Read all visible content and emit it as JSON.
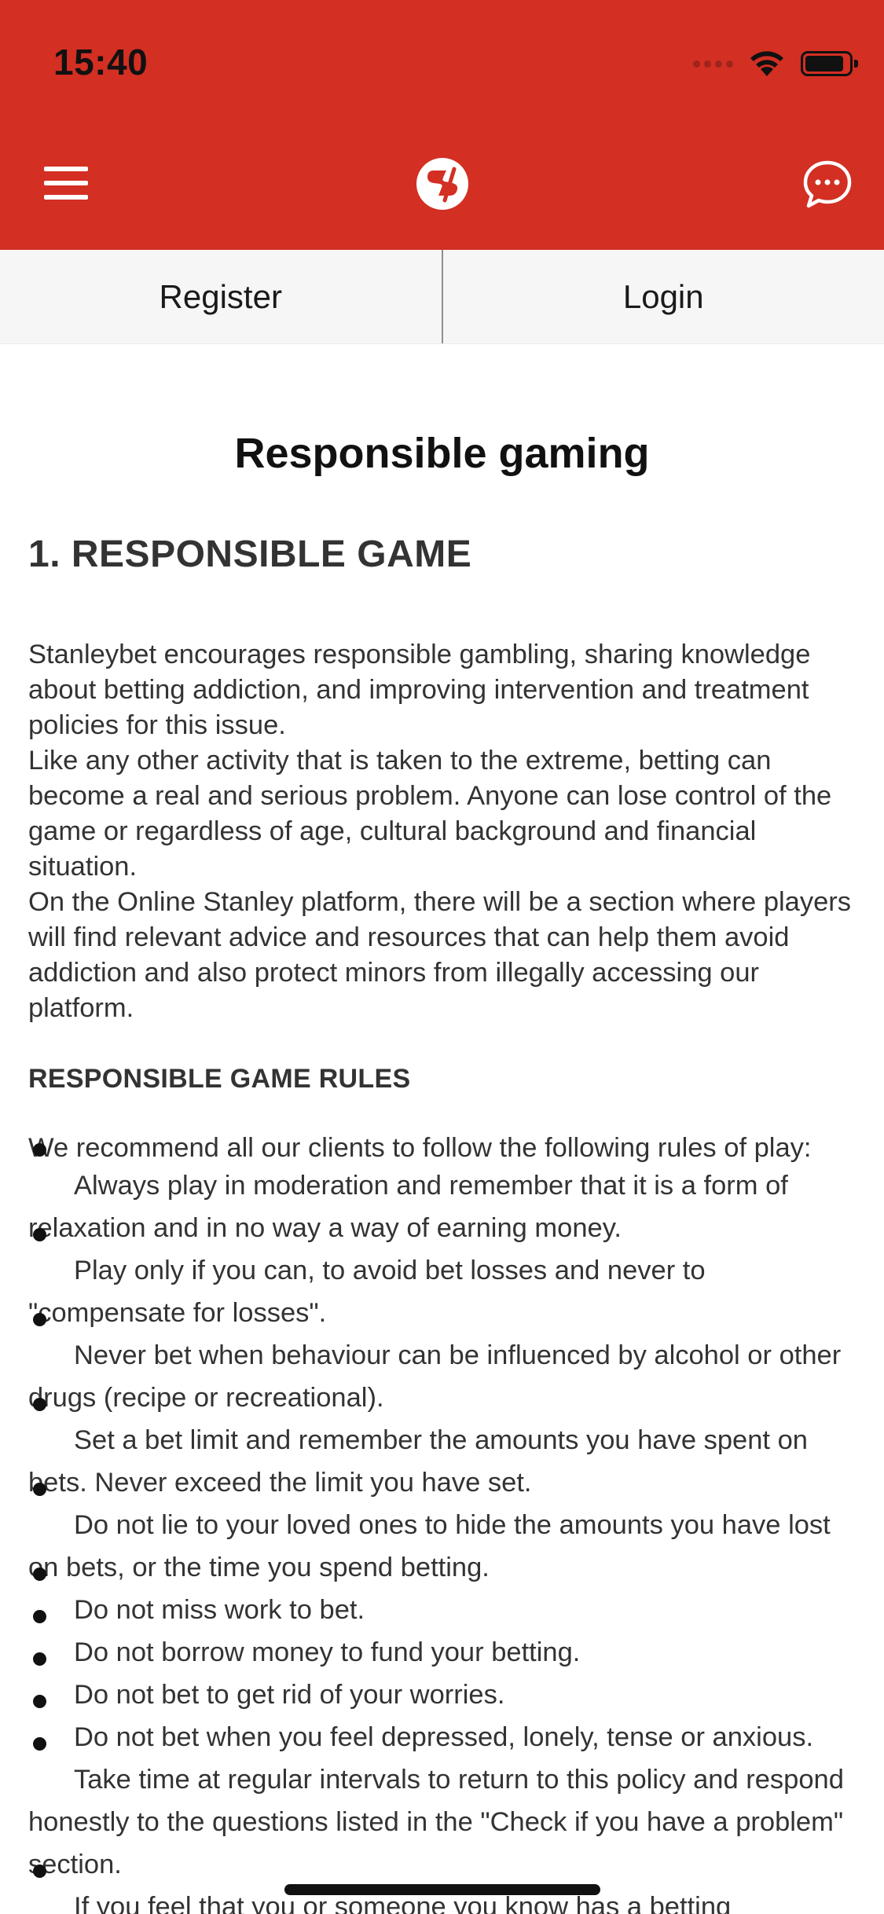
{
  "status_bar": {
    "time": "15:40"
  },
  "header": {
    "menu_icon": "hamburger-menu-icon",
    "logo_icon": "stanleybet-logo-icon",
    "chat_icon": "chat-bubble-icon",
    "background_color": "#d32f23"
  },
  "tabs": {
    "register_label": "Register",
    "login_label": "Login"
  },
  "content": {
    "page_title": "Responsible gaming",
    "section_title": "1. RESPONSIBLE GAME",
    "paragraphs": [
      "Stanleybet encourages responsible gambling, sharing knowledge about betting addiction, and improving intervention and treatment policies for this issue.",
      "Like any other activity that is taken to the extreme, betting can become a real and serious problem. Anyone can lose control of the game or regardless of age, cultural background and financial situation.",
      "On the Online Stanley platform, there will be a section where players will find relevant advice and resources that can help them avoid addiction and also protect minors from illegally accessing our platform."
    ],
    "rules_title": "RESPONSIBLE GAME RULES",
    "rules_intro": "We recommend all our clients to follow the following rules of play:",
    "rules": [
      "Always play in moderation and remember that it is a form of relaxation and in no way a way of earning money.",
      "Play only if you can, to avoid bet losses and never to \"compensate for losses\".",
      "Never bet when behaviour can be influenced by alcohol or other drugs (recipe or recreational).",
      "Set a bet limit and remember the amounts you have spent on bets. Never exceed the limit you have set.",
      "Do not lie to your loved ones to hide the amounts you have lost on bets, or the time you spend betting.",
      "Do not miss work to bet.",
      "Do not borrow money to fund your betting.",
      "Do not bet to get rid of your worries.",
      "Do not bet when you feel depressed, lonely, tense or anxious.",
      "Take time at regular intervals to return to this policy and respond honestly to the questions listed in the \"Check if you have a problem\" section.",
      "If you feel that you or someone you know has a betting"
    ]
  }
}
